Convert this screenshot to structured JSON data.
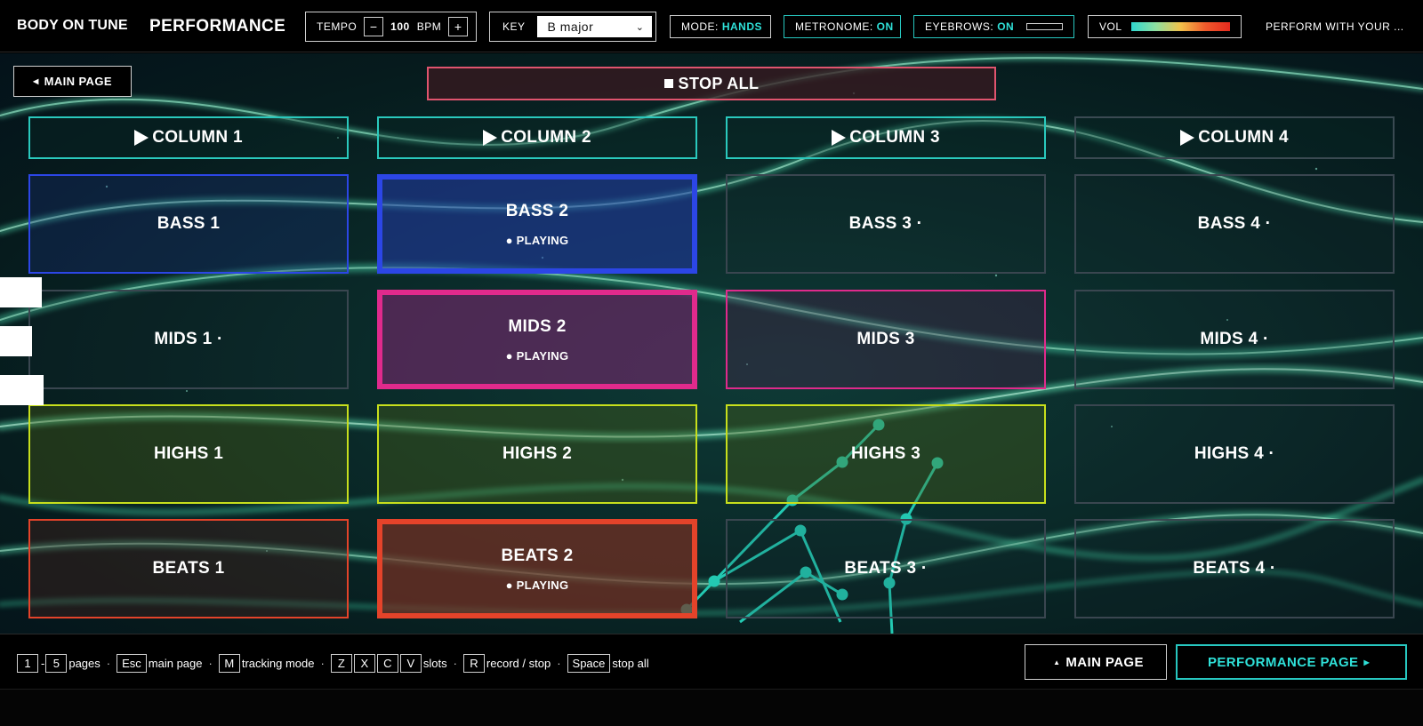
{
  "app": {
    "brand": "BODY ON TUNE",
    "page": "PERFORMANCE",
    "tagline": "PERFORM WITH YOUR ..."
  },
  "toolbar": {
    "tempo": {
      "label": "TEMPO",
      "minus": "−",
      "value": "100",
      "unit": "BPM",
      "plus": "+"
    },
    "key": {
      "label": "KEY",
      "selected": "B major"
    },
    "mode": {
      "label": "MODE:",
      "value": "HANDS"
    },
    "metronome": {
      "label": "METRONOME:",
      "value": "ON"
    },
    "eyebrows": {
      "label": "EYEBROWS:",
      "value": "ON"
    },
    "volume": {
      "label": "VOL"
    }
  },
  "stage": {
    "main_page": "MAIN PAGE",
    "stop_all": "STOP ALL",
    "columns": [
      "COLUMN 1",
      "COLUMN 2",
      "COLUMN 3",
      "COLUMN 4"
    ],
    "rows": {
      "bass": [
        "BASS 1",
        "BASS 2",
        "BASS 3 ·",
        "BASS 4 ·"
      ],
      "mids": [
        "MIDS 1 ·",
        "MIDS 2",
        "MIDS 3",
        "MIDS 4 ·"
      ],
      "highs": [
        "HIGHS 1",
        "HIGHS 2",
        "HIGHS 3",
        "HIGHS 4 ·"
      ],
      "beats": [
        "BEATS 1",
        "BEATS 2",
        "BEATS 3 ·",
        "BEATS 4 ·"
      ]
    },
    "playing_label": "● PLAYING"
  },
  "footer": {
    "shortcuts": {
      "k1": "1",
      "k5": "5",
      "pages": "pages",
      "esc": "Esc",
      "main_page": "main page",
      "m": "M",
      "tracking": "tracking mode",
      "z": "Z",
      "x": "X",
      "c": "C",
      "v": "V",
      "slots": "slots",
      "r": "R",
      "record": "record / stop",
      "space": "Space",
      "stop_all": "stop all"
    },
    "main_page_btn": "MAIN PAGE",
    "performance_btn": "PERFORMANCE PAGE"
  },
  "colors": {
    "accent_teal": "#2fe0d8",
    "bass": "#2c46e6",
    "mids": "#e02a8c",
    "highs": "#c7df1c",
    "beats": "#e4432a",
    "stop": "#e0546e"
  }
}
